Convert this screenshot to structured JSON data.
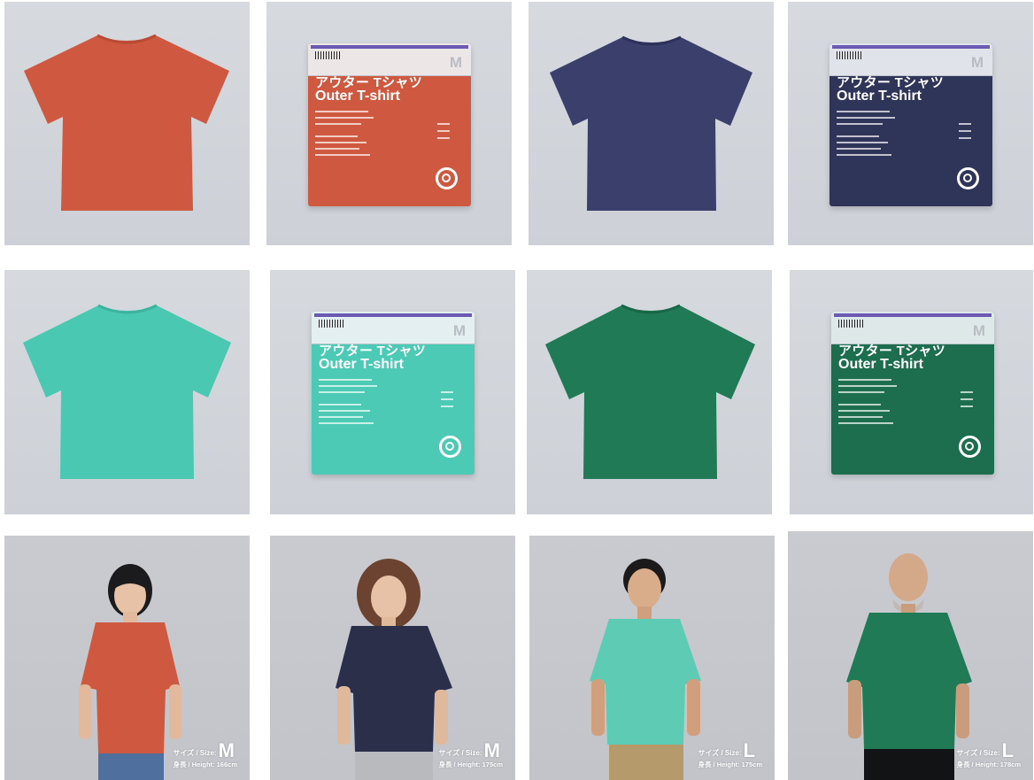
{
  "colors": {
    "orange": "#cf5940",
    "navy": "#3b3f6b",
    "aqua": "#4ac8b2",
    "green": "#1f7a55"
  },
  "products": [
    {
      "view": "flat",
      "color": "orange",
      "icon": "tshirt-icon"
    },
    {
      "view": "package",
      "color": "orange",
      "jp_title": "アウター Tシャツ",
      "en_title": "Outer T-shirt",
      "size": "M"
    },
    {
      "view": "flat",
      "color": "navy",
      "icon": "tshirt-icon"
    },
    {
      "view": "package",
      "color": "navy",
      "jp_title": "アウター Tシャツ",
      "en_title": "Outer T-shirt",
      "size": "M"
    },
    {
      "view": "flat",
      "color": "aqua",
      "icon": "tshirt-icon"
    },
    {
      "view": "package",
      "color": "aqua",
      "jp_title": "アウター Tシャツ",
      "en_title": "Outer T-shirt",
      "size": "M"
    },
    {
      "view": "flat",
      "color": "green",
      "icon": "tshirt-icon"
    },
    {
      "view": "package",
      "color": "green",
      "jp_title": "アウター Tシャツ",
      "en_title": "Outer T-shirt",
      "size": "M"
    }
  ],
  "models": [
    {
      "shirt": "orange",
      "size_prefix": "サイズ / Size:",
      "size": "M",
      "height": "身長 / Height: 166cm"
    },
    {
      "shirt": "navy",
      "size_prefix": "サイズ / Size:",
      "size": "M",
      "height": "身長 / Height: 175cm"
    },
    {
      "shirt": "aqua",
      "size_prefix": "サイズ / Size:",
      "size": "L",
      "height": "身長 / Height: 175cm"
    },
    {
      "shirt": "green",
      "size_prefix": "サイズ / Size:",
      "size": "L",
      "height": "身長 / Height: 178cm"
    }
  ]
}
